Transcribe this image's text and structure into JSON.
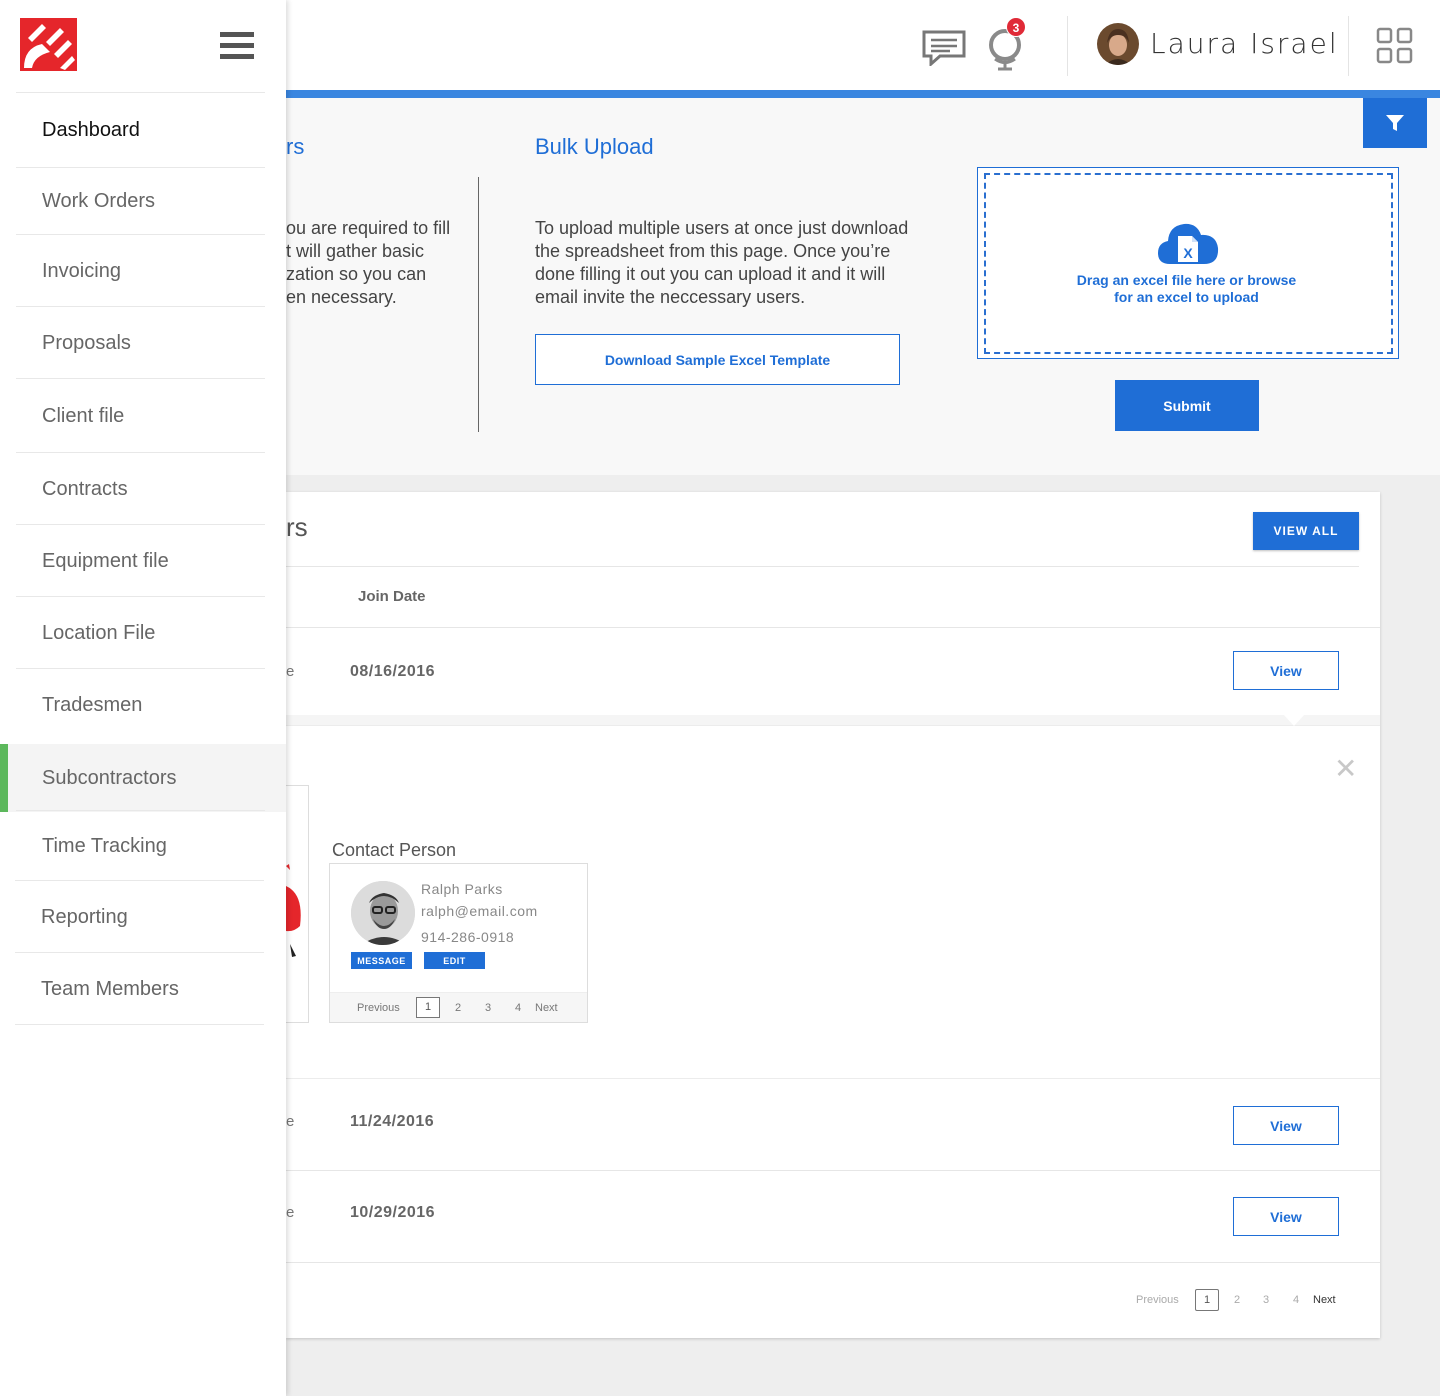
{
  "header": {
    "user_name": "Laura Israel",
    "notification_count": "3",
    "icons": [
      "chat-icon",
      "globe-notification-icon",
      "user-avatar",
      "apps-grid-icon"
    ]
  },
  "sidebar": {
    "items": [
      {
        "label": "Dashboard"
      },
      {
        "label": "Work Orders"
      },
      {
        "label": "Invoicing"
      },
      {
        "label": "Proposals"
      },
      {
        "label": "Client file"
      },
      {
        "label": "Contracts"
      },
      {
        "label": "Equipment file"
      },
      {
        "label": "Location File"
      },
      {
        "label": "Tradesmen"
      },
      {
        "label": "Subcontractors"
      },
      {
        "label": "Time Tracking"
      },
      {
        "label": "Reporting"
      },
      {
        "label": "Team Members"
      }
    ],
    "active": "Subcontractors"
  },
  "upload": {
    "left_title_fragment": "rs",
    "left_desc_lines": [
      "ou are required to fill",
      "t will gather basic",
      "zation so you can",
      "en necessary."
    ],
    "bulk_title": "Bulk Upload",
    "bulk_desc": "To upload multiple users at once just download the spreadsheet from this page. Once you’re done filling it out you can upload it and it will email invite the neccessary users.",
    "download_label": "Download Sample Excel Template",
    "drop_text_line1": "Drag an excel file here or browse",
    "drop_text_line2": "for an excel to upload",
    "submit_label": "Submit"
  },
  "list": {
    "title_fragment": "rs",
    "view_all_label": "VIEW ALL",
    "col_join_date": "Join Date",
    "rows": [
      {
        "frag": "e",
        "date": "08/16/2016",
        "action": "View"
      },
      {
        "frag": "e",
        "date": "11/24/2016",
        "action": "View"
      },
      {
        "frag": "e",
        "date": "10/29/2016",
        "action": "View"
      }
    ],
    "pager": {
      "prev": "Previous",
      "pages": [
        "1",
        "2",
        "3",
        "4"
      ],
      "next": "Next",
      "current": "1"
    }
  },
  "details": {
    "contact_label": "Contact Person",
    "contact": {
      "name": "Ralph Parks",
      "email": "ralph@email.com",
      "phone": "914-286-0918",
      "message_label": "MESSAGE",
      "edit_label": "EDIT"
    },
    "pager": {
      "prev": "Previous",
      "pages": [
        "1",
        "2",
        "3",
        "4"
      ],
      "next": "Next",
      "current": "1"
    },
    "close_glyph": "✕"
  },
  "colors": {
    "accent": "#1f6ed6",
    "active_indicator": "#5cb85c",
    "badge": "#e02a37",
    "brand": "#e5262b"
  }
}
